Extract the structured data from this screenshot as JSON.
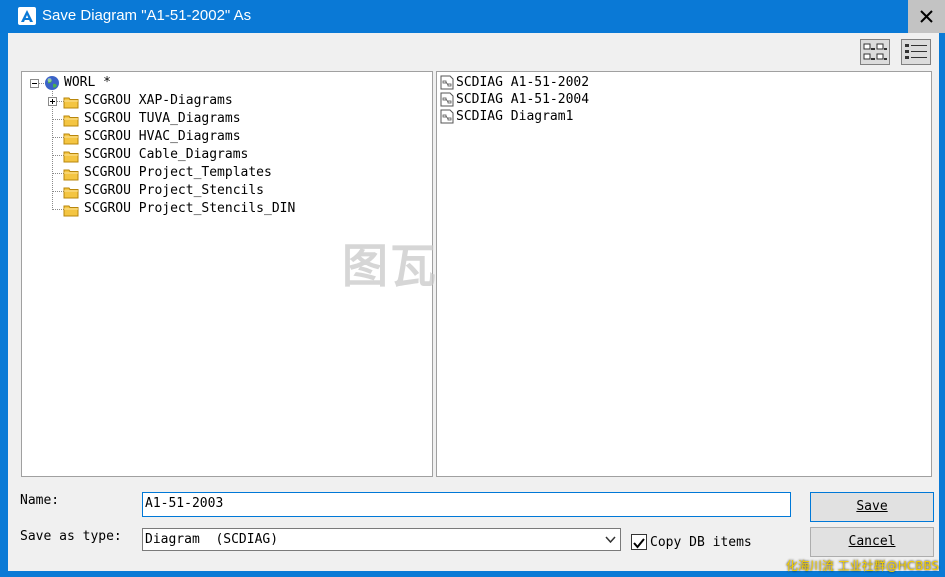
{
  "window": {
    "title": "Save Diagram \"A1-51-2002\" As"
  },
  "tree": {
    "root_label": "WORL *",
    "items": [
      {
        "label": "SCGROU XAP-Diagrams",
        "expandable": true
      },
      {
        "label": "SCGROU TUVA_Diagrams",
        "expandable": false
      },
      {
        "label": "SCGROU HVAC_Diagrams",
        "expandable": false
      },
      {
        "label": "SCGROU Cable_Diagrams",
        "expandable": false
      },
      {
        "label": "SCGROU Project_Templates",
        "expandable": false
      },
      {
        "label": "SCGROU Project_Stencils",
        "expandable": false
      },
      {
        "label": "SCGROU Project_Stencils_DIN",
        "expandable": false
      }
    ]
  },
  "files": {
    "items": [
      {
        "label": "SCDIAG A1-51-2002"
      },
      {
        "label": "SCDIAG A1-51-2004"
      },
      {
        "label": "SCDIAG Diagram1"
      }
    ]
  },
  "form": {
    "name_label": "Name:",
    "name_value": "A1-51-2003",
    "type_label": "Save as type:",
    "type_value": "Diagram  (SCDIAG)",
    "copy_db_label": "Copy DB items",
    "copy_db_checked": true
  },
  "buttons": {
    "save_label": "Save",
    "cancel_label": "Cancel"
  },
  "overlay": {
    "watermark": "图瓦",
    "credit": "化海川流 工业社群@HCBBS"
  },
  "colors": {
    "title_bar": "#0a79d6",
    "focus": "#0078d7",
    "folder": "#f4c542"
  }
}
